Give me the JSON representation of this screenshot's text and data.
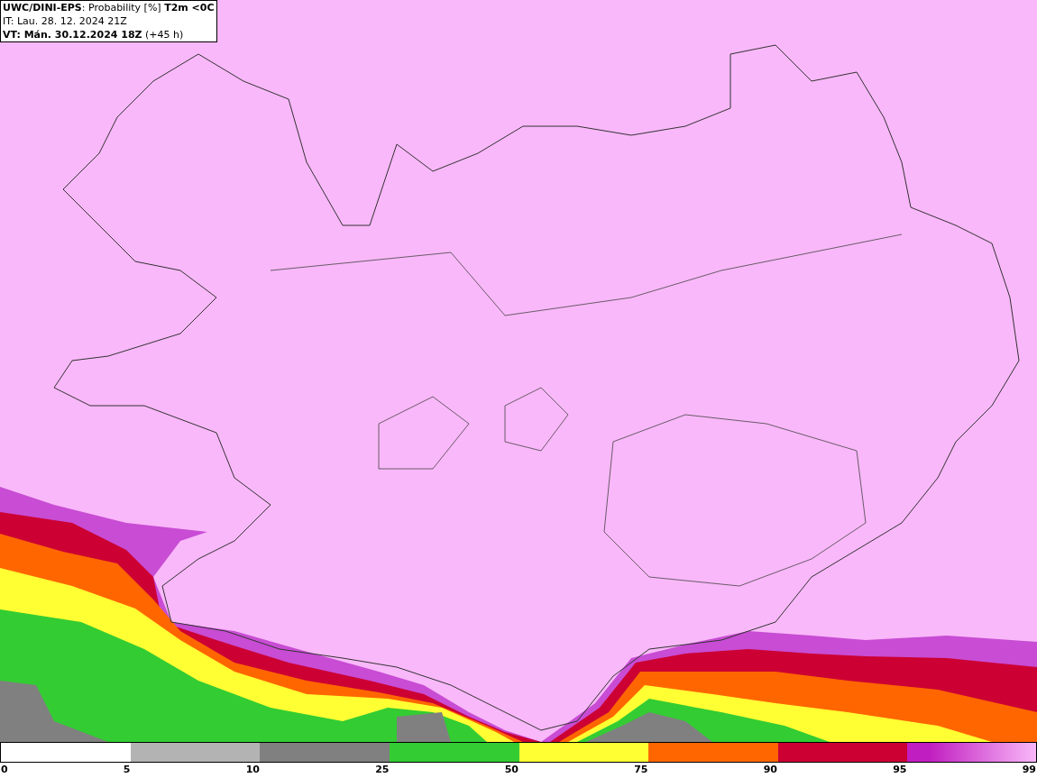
{
  "header": {
    "title": "**UWC/DINI-EPS**: Probability [%] **T2m <0C**",
    "issue_time": "IT: Lau. 28. 12. 2024 21Z",
    "valid_time": "**VT: Mán. 30.12.2024 18Z** (+45 h)"
  },
  "legend": {
    "segments": [
      {
        "color": "#ffffff"
      },
      {
        "color": "#b3b3b3"
      },
      {
        "color": "#808080"
      },
      {
        "color": "#33cc33"
      },
      {
        "color": "#ffff33"
      },
      {
        "color": "#ff6600"
      },
      {
        "color": "#cc0033"
      },
      {
        "color": "#c01ec0"
      }
    ],
    "labels": [
      "0",
      "5",
      "10",
      "25",
      "50",
      "75",
      "90",
      "95",
      "99"
    ]
  }
}
